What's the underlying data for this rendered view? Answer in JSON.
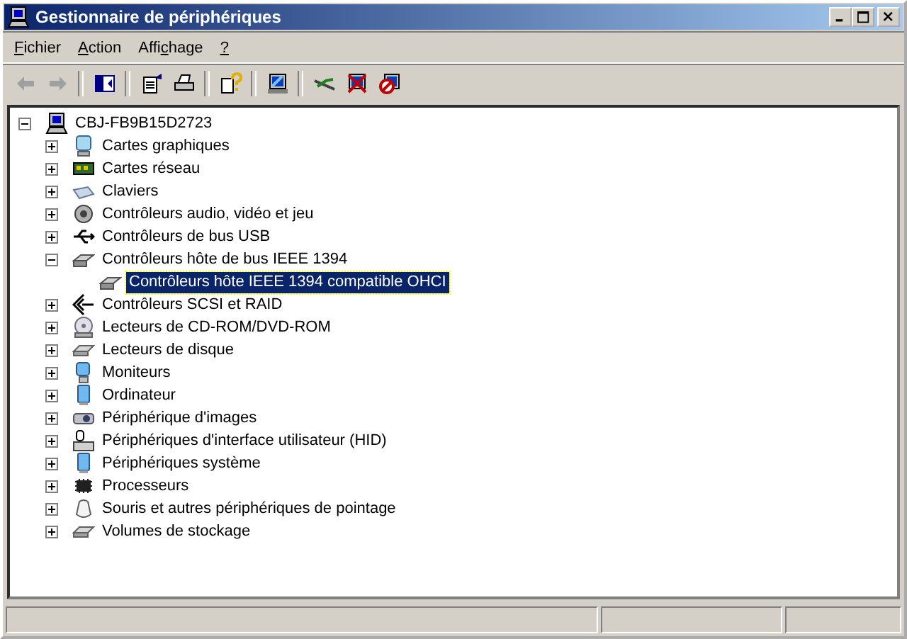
{
  "window": {
    "title": "Gestionnaire de périphériques"
  },
  "menu": [
    {
      "key": "F",
      "post": "ichier"
    },
    {
      "key": "A",
      "post": "ction"
    },
    {
      "pre": "Affi",
      "key": "c",
      "post": "hage"
    },
    {
      "key": "?"
    }
  ],
  "toolbar": [
    {
      "kind": "back",
      "disabled": true
    },
    {
      "kind": "forward",
      "disabled": true
    },
    {
      "kind": "separator"
    },
    {
      "kind": "tree"
    },
    {
      "kind": "separator"
    },
    {
      "kind": "properties"
    },
    {
      "kind": "print"
    },
    {
      "kind": "separator"
    },
    {
      "kind": "help"
    },
    {
      "kind": "separator"
    },
    {
      "kind": "update"
    },
    {
      "kind": "separator"
    },
    {
      "kind": "scan"
    },
    {
      "kind": "uninstall"
    },
    {
      "kind": "disable"
    }
  ],
  "tree": [
    {
      "label": "CBJ-FB9B15D2723",
      "kind": "computer",
      "expanded": true,
      "selected": false,
      "children": [
        {
          "label": "Cartes graphiques",
          "kind": "display",
          "expanded": false,
          "selected": false
        },
        {
          "label": "Cartes réseau",
          "kind": "network",
          "expanded": false,
          "selected": false
        },
        {
          "label": "Claviers",
          "kind": "keyboard",
          "expanded": false,
          "selected": false
        },
        {
          "label": "Contrôleurs audio, vidéo et jeu",
          "kind": "sound",
          "expanded": false,
          "selected": false
        },
        {
          "label": "Contrôleurs de bus USB",
          "kind": "usb",
          "expanded": false,
          "selected": false
        },
        {
          "label": "Contrôleurs hôte de bus IEEE 1394",
          "kind": "card",
          "expanded": true,
          "selected": false,
          "children": [
            {
              "label": "Contrôleurs hôte IEEE 1394 compatible OHCI",
              "kind": "card",
              "selected": true
            }
          ]
        },
        {
          "label": "Contrôleurs SCSI et RAID",
          "kind": "scsi",
          "expanded": false,
          "selected": false
        },
        {
          "label": "Lecteurs de CD-ROM/DVD-ROM",
          "kind": "cdrom",
          "expanded": false,
          "selected": false
        },
        {
          "label": "Lecteurs de disque",
          "kind": "disk",
          "expanded": false,
          "selected": false
        },
        {
          "label": "Moniteurs",
          "kind": "monitor",
          "expanded": false,
          "selected": false
        },
        {
          "label": "Ordinateur",
          "kind": "pc",
          "expanded": false,
          "selected": false
        },
        {
          "label": "Périphérique d'images",
          "kind": "camera",
          "expanded": false,
          "selected": false
        },
        {
          "label": "Périphériques d'interface utilisateur (HID)",
          "kind": "hid",
          "expanded": false,
          "selected": false
        },
        {
          "label": "Périphériques système",
          "kind": "pc",
          "expanded": false,
          "selected": false
        },
        {
          "label": "Processeurs",
          "kind": "chip",
          "expanded": false,
          "selected": false
        },
        {
          "label": "Souris et autres périphériques de pointage",
          "kind": "mouse",
          "expanded": false,
          "selected": false
        },
        {
          "label": "Volumes de stockage",
          "kind": "disk",
          "expanded": false,
          "selected": false
        }
      ]
    }
  ]
}
